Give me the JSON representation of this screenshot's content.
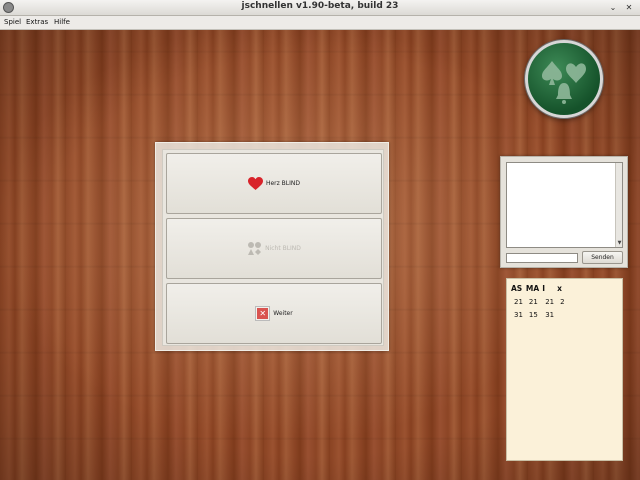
{
  "window": {
    "title": "jschnellen v1.90-beta, build 23",
    "minimize_icon": "chevron-down-icon",
    "close_icon": "close-icon"
  },
  "menu": {
    "items": [
      "Spiel",
      "Extras",
      "Hilfe"
    ]
  },
  "panel": {
    "buttons": [
      {
        "label": "Herz BLIND",
        "icon": "heart-icon",
        "enabled": true
      },
      {
        "label": "Nicht BLIND",
        "icon": "card-suits-icon",
        "enabled": false
      },
      {
        "label": "Weiter",
        "icon": "close-icon",
        "enabled": true
      }
    ]
  },
  "chat": {
    "input_value": "",
    "send_label": "Senden"
  },
  "score": {
    "headers": [
      "AS",
      "MA",
      "I",
      "x"
    ],
    "rows": [
      [
        "21",
        "21",
        "21",
        "2"
      ],
      [
        "31",
        "15",
        "31",
        ""
      ]
    ]
  },
  "colors": {
    "heart": "#d8232a",
    "logo_green": "#1f6b3a"
  }
}
